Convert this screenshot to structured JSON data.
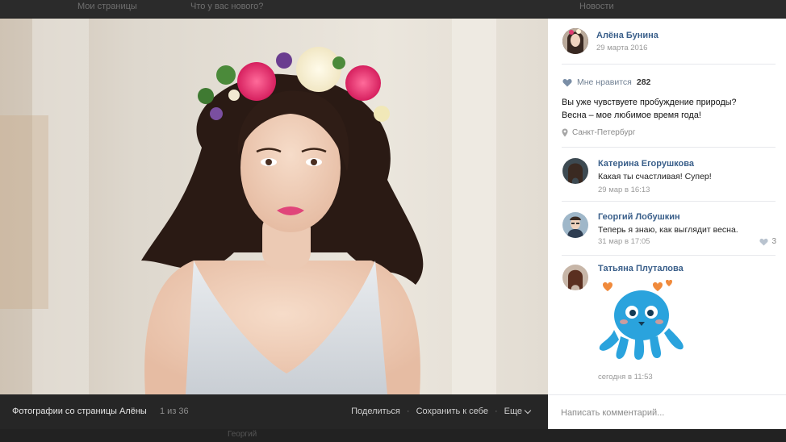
{
  "background_page": {
    "top_items": [
      "Мои страницы",
      "Что у вас нового?",
      "Новости"
    ],
    "bottom_text": "Георгий"
  },
  "photo_viewer": {
    "album_title": "Фотографии со страницы Алёны",
    "counter": "1 из 36",
    "actions": {
      "share": "Поделиться",
      "save": "Сохранить к себе",
      "more": "Еще"
    },
    "separator": "·"
  },
  "post": {
    "author": "Алёна Бунина",
    "date": "29 марта 2016",
    "likes_label": "Мне нравится",
    "likes_count": "282",
    "text_line1": "Вы уже чувствуете пробуждение природы?",
    "text_line2": "Весна – мое любимое время года!",
    "location": "Санкт-Петербург"
  },
  "comments": [
    {
      "author": "Катерина Егорушкова",
      "text": "Какая ты счастливая! Супер!",
      "date": "29 мар в 16:13"
    },
    {
      "author": "Георгий Лобушкин",
      "text": "Теперь я знаю, как выглядит весна.",
      "date": "31 мар в 17:05",
      "likes": "3"
    },
    {
      "author": "Татьяна Плуталова",
      "text": "",
      "date": "сегодня в 11:53",
      "sticker": "octopus-sticker"
    }
  ],
  "comment_input": {
    "placeholder": "Написать комментарий..."
  },
  "colors": {
    "accent_name": "#3a5f8a",
    "panel_bg": "#ffffff",
    "photo_bar_bg": "#262626",
    "sticker_body": "#2aa3dd",
    "heart": "#f08a3c"
  }
}
